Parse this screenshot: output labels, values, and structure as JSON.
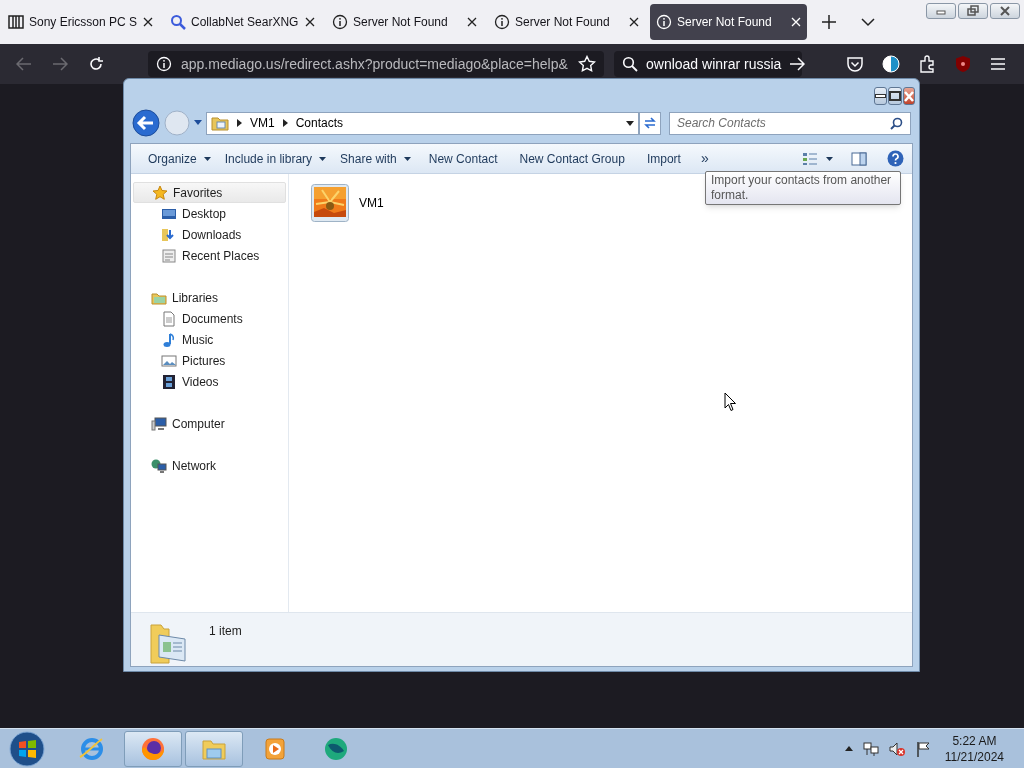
{
  "browser": {
    "tabs": [
      {
        "label": "Sony Ericsson PC S",
        "selected": false
      },
      {
        "label": "CollabNet SearXNG",
        "selected": false
      },
      {
        "label": "Server Not Found",
        "selected": false
      },
      {
        "label": "Server Not Found",
        "selected": false
      },
      {
        "label": "Server Not Found",
        "selected": true
      }
    ],
    "url": "app.mediago.us/redirect.ashx?product=mediago&place=help&",
    "search_value": "ownload winrar russia"
  },
  "explorer": {
    "breadcrumbs": [
      "VM1",
      "Contacts"
    ],
    "search_placeholder": "Search Contacts",
    "toolbar": [
      {
        "label": "Organize",
        "kind": "menu"
      },
      {
        "label": "Include in library",
        "kind": "menu"
      },
      {
        "label": "Share with",
        "kind": "menu"
      },
      {
        "label": "New Contact",
        "kind": "button"
      },
      {
        "label": "New Contact Group",
        "kind": "button"
      },
      {
        "label": "Import",
        "kind": "button"
      },
      {
        "label": "»",
        "kind": "more"
      }
    ],
    "tooltip": "Import your contacts from another format.",
    "sidebar": [
      {
        "label": "Favorites",
        "selected": true,
        "children": [
          {
            "label": "Desktop"
          },
          {
            "label": "Downloads"
          },
          {
            "label": "Recent Places"
          }
        ]
      },
      {
        "label": "Libraries",
        "selected": false,
        "children": [
          {
            "label": "Documents"
          },
          {
            "label": "Music"
          },
          {
            "label": "Pictures"
          },
          {
            "label": "Videos"
          }
        ]
      },
      {
        "label": "Computer",
        "selected": false
      },
      {
        "label": "Network",
        "selected": false
      }
    ],
    "items": [
      {
        "label": "VM1"
      }
    ],
    "status": "1 item"
  },
  "taskbar": {
    "apps": [
      {
        "active": false
      },
      {
        "active": true
      },
      {
        "active": true
      },
      {
        "active": false
      },
      {
        "active": false
      }
    ],
    "time": "5:22 AM",
    "date": "11/21/2024"
  }
}
